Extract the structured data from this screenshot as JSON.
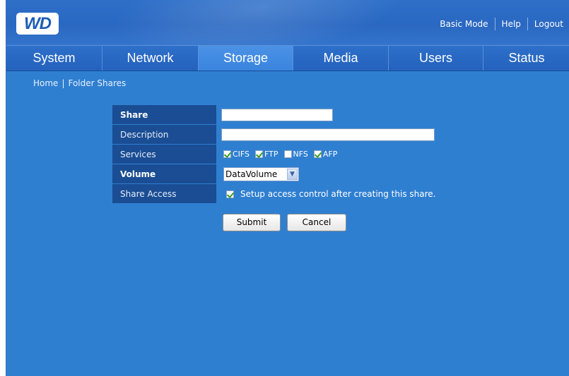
{
  "header": {
    "logo_text": "WD",
    "links": [
      "Basic Mode",
      "Help",
      "Logout"
    ]
  },
  "tabs": [
    {
      "label": "System",
      "active": false
    },
    {
      "label": "Network",
      "active": false
    },
    {
      "label": "Storage",
      "active": true
    },
    {
      "label": "Media",
      "active": false
    },
    {
      "label": "Users",
      "active": false
    },
    {
      "label": "Status",
      "active": false
    }
  ],
  "breadcrumb": {
    "home": "Home",
    "separator": "|",
    "current": "Folder Shares"
  },
  "form": {
    "share_label": "Share",
    "share_value": "",
    "description_label": "Description",
    "description_value": "",
    "services_label": "Services",
    "services": [
      {
        "label": "CIFS",
        "checked": true
      },
      {
        "label": "FTP",
        "checked": true
      },
      {
        "label": "NFS",
        "checked": false
      },
      {
        "label": "AFP",
        "checked": true
      }
    ],
    "volume_label": "Volume",
    "volume_value": "DataVolume",
    "share_access_label": "Share Access",
    "share_access_checked": true,
    "share_access_text": "Setup access control after creating this share.",
    "submit_label": "Submit",
    "cancel_label": "Cancel"
  },
  "colors": {
    "background": "#2f7fd1",
    "label_cell": "#1a4d93",
    "active_tab": "#4b92e6",
    "check": "#3a9a26"
  }
}
